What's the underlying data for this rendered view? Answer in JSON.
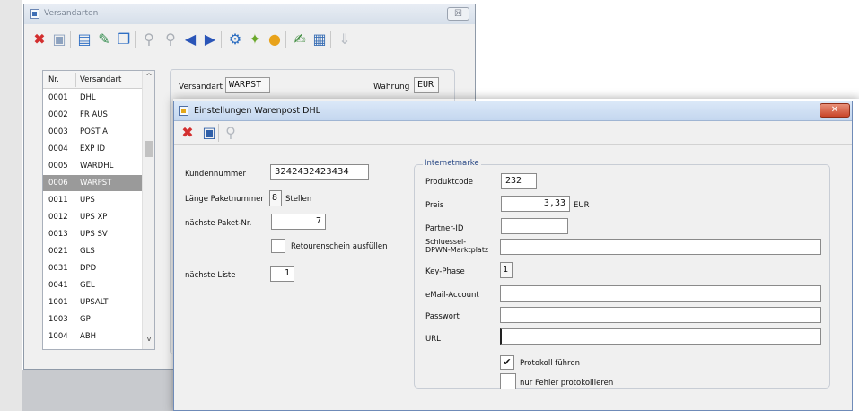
{
  "main_window": {
    "title": "Versandarten",
    "close_glyph": "☒",
    "toolbar": [
      {
        "name": "delete-icon",
        "glyph": "✖",
        "color": "#d32f2f"
      },
      {
        "name": "save-icon",
        "glyph": "▣",
        "color": "#8da2bf"
      },
      {
        "name": "new-icon",
        "glyph": "▤",
        "color": "#2f6fc4"
      },
      {
        "name": "edit-icon",
        "glyph": "✎",
        "color": "#2f8a4a"
      },
      {
        "name": "window-icon",
        "glyph": "❐",
        "color": "#2f6fc4"
      },
      {
        "name": "filter-icon",
        "glyph": "⚲",
        "color": "#a9aeb5"
      },
      {
        "name": "search-icon",
        "glyph": "⚲",
        "color": "#a9aeb5"
      },
      {
        "name": "first-icon",
        "glyph": "◀",
        "color": "#2a55b8"
      },
      {
        "name": "last-icon",
        "glyph": "▶",
        "color": "#2a55b8"
      },
      {
        "name": "settings-icon",
        "glyph": "⚙",
        "color": "#2a6cc0"
      },
      {
        "name": "tools-icon",
        "glyph": "✦",
        "color": "#6aa82b"
      },
      {
        "name": "currency-icon",
        "glyph": "●",
        "color": "#e8a21a"
      },
      {
        "name": "notes-icon",
        "glyph": "✍",
        "color": "#3c8a3c"
      },
      {
        "name": "document-icon",
        "glyph": "▦",
        "color": "#3a6fb5"
      },
      {
        "name": "download-icon",
        "glyph": "⇓",
        "color": "#b8bdc4"
      }
    ],
    "list": {
      "col_nr": "Nr.",
      "col_versandart": "Versandart",
      "scroll_up": "^",
      "scroll_down": "v",
      "rows": [
        {
          "nr": "0001",
          "name": "DHL"
        },
        {
          "nr": "0002",
          "name": "FR AUS"
        },
        {
          "nr": "0003",
          "name": "POST A"
        },
        {
          "nr": "0004",
          "name": "EXP ID"
        },
        {
          "nr": "0005",
          "name": "WARDHL"
        },
        {
          "nr": "0006",
          "name": "WARPST",
          "selected": true
        },
        {
          "nr": "0011",
          "name": "UPS"
        },
        {
          "nr": "0012",
          "name": "UPS XP"
        },
        {
          "nr": "0013",
          "name": "UPS SV"
        },
        {
          "nr": "0021",
          "name": "GLS"
        },
        {
          "nr": "0031",
          "name": "DPD"
        },
        {
          "nr": "0041",
          "name": "GEL"
        },
        {
          "nr": "1001",
          "name": "UPSALT"
        },
        {
          "nr": "1003",
          "name": "GP"
        },
        {
          "nr": "1004",
          "name": "ABH"
        }
      ]
    },
    "detail": {
      "versandart_label": "Versandart",
      "versandart_value": "WARPST",
      "waehrung_label": "Währung",
      "waehrung_value": "EUR"
    }
  },
  "dialog": {
    "title": "Einstellungen Warenpost DHL",
    "close_glyph": "✕",
    "toolbar": [
      {
        "name": "delete-icon",
        "glyph": "✖",
        "color": "#d32f2f"
      },
      {
        "name": "save-icon",
        "glyph": "▣",
        "color": "#2f5fa8"
      },
      {
        "name": "search-icon",
        "glyph": "⚲",
        "color": "#b3b8bf"
      }
    ],
    "left": {
      "kundennummer_label": "Kundennummer",
      "kundennummer_value": "3242432423434",
      "laenge_label": "Länge Paketnummer",
      "laenge_value": "8",
      "laenge_unit": "Stellen",
      "paket_nr_label": "nächste Paket-Nr.",
      "paket_nr_value": "7",
      "retoure_label": "Retourenschein ausfüllen",
      "retoure_checked": false,
      "liste_label": "nächste Liste",
      "liste_value": "1"
    },
    "internetmarke": {
      "title": "Internetmarke",
      "produktcode_label": "Produktcode",
      "produktcode_value": "232",
      "preis_label": "Preis",
      "preis_value": "3,33",
      "preis_unit": "EUR",
      "partner_label": "Partner-ID",
      "partner_value": "",
      "schluessel_label_1": "Schluessel-",
      "schluessel_label_2": "DPWN-Marktplatz",
      "schluessel_value": "",
      "keyphase_label": "Key-Phase",
      "keyphase_value": "1",
      "email_label": "eMail-Account",
      "email_value": "",
      "passwort_label": "Passwort",
      "passwort_value": "",
      "url_label": "URL",
      "url_value": "",
      "protokoll_label": "Protokoll führen",
      "protokoll_checked": true,
      "protokoll_check_glyph": "✔",
      "fehler_label": "nur Fehler protokollieren",
      "fehler_checked": false
    }
  }
}
